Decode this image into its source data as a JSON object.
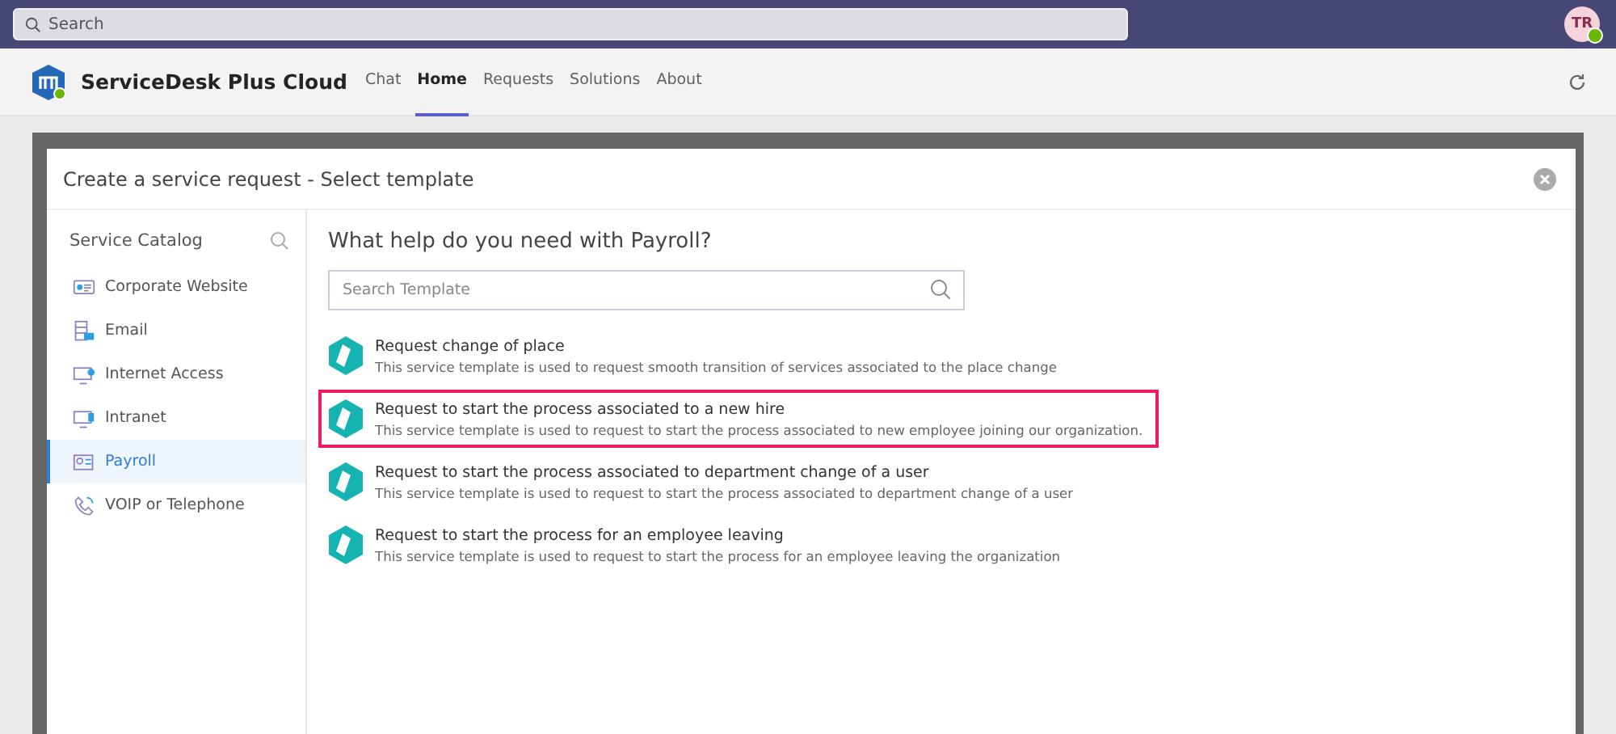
{
  "top_bar": {
    "search_placeholder": "Search",
    "avatar": "TR"
  },
  "app": {
    "name": "ServiceDesk Plus Cloud",
    "tabs": [
      {
        "label": "Chat",
        "selected": false
      },
      {
        "label": "Home",
        "selected": true
      },
      {
        "label": "Requests",
        "selected": false
      },
      {
        "label": "Solutions",
        "selected": false
      },
      {
        "label": "About",
        "selected": false
      }
    ]
  },
  "dialog": {
    "title": "Create a service request - Select template",
    "sidebar": {
      "title": "Service Catalog",
      "items": [
        {
          "label": "Corporate Website",
          "kind": "website",
          "selected": false
        },
        {
          "label": "Email",
          "kind": "email",
          "selected": false
        },
        {
          "label": "Internet Access",
          "kind": "internet",
          "selected": false
        },
        {
          "label": "Intranet",
          "kind": "intranet",
          "selected": false
        },
        {
          "label": "Payroll",
          "kind": "payroll",
          "selected": true
        },
        {
          "label": "VOIP or Telephone",
          "kind": "phone",
          "selected": false
        }
      ]
    },
    "heading": "What help do you need with Payroll?",
    "search_placeholder": "Search Template",
    "templates": [
      {
        "title": "Request change of place",
        "description": "This service template is used to request smooth transition of services associated to the place change",
        "selected": false
      },
      {
        "title": "Request to start the process associated to a new hire",
        "description": "This service template is used to request to start the process associated to new employee joining our organization.",
        "selected": true
      },
      {
        "title": "Request to start the process associated to department change of a user",
        "description": "This service template is used to request to start the process associated to department change of a user",
        "selected": false
      },
      {
        "title": "Request to start the process for an employee leaving",
        "description": "This service template is used to request to start the process for an employee leaving the organization",
        "selected": false
      }
    ]
  }
}
